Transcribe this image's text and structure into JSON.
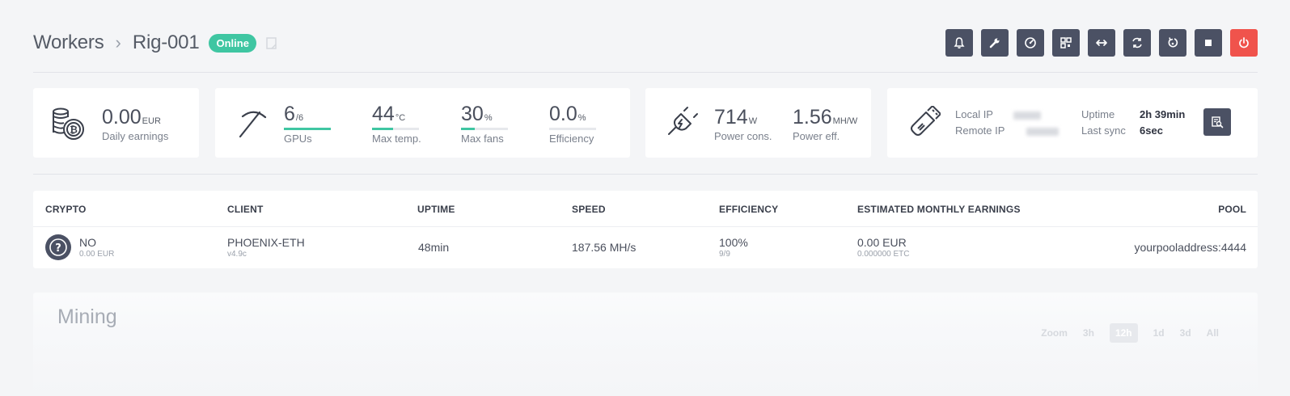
{
  "header": {
    "breadcrumb_root": "Workers",
    "separator": "›",
    "rig_name": "Rig-001",
    "status": "Online",
    "colors": {
      "status": "#3fc6a2",
      "action_bg": "#4b5164",
      "danger": "#f0534c"
    },
    "actions": [
      {
        "name": "notifications-button",
        "icon": "bell-icon"
      },
      {
        "name": "settings-button",
        "icon": "wrench-icon"
      },
      {
        "name": "overclock-button",
        "icon": "gauge-icon"
      },
      {
        "name": "qr-button",
        "icon": "qrcode-icon"
      },
      {
        "name": "transfer-button",
        "icon": "arrows-horizontal-icon"
      },
      {
        "name": "sync-button",
        "icon": "sync-icon"
      },
      {
        "name": "restart-button",
        "icon": "restart-icon"
      },
      {
        "name": "stop-button",
        "icon": "stop-icon"
      },
      {
        "name": "power-button",
        "icon": "power-icon"
      }
    ]
  },
  "earnings": {
    "value": "0.00",
    "unit": "EUR",
    "label": "Daily earnings"
  },
  "gpus": {
    "value": "6",
    "unit": "/6",
    "label": "GPUs",
    "level": 1.0
  },
  "temp": {
    "value": "44",
    "unit": "°C",
    "label": "Max temp.",
    "level": 0.44
  },
  "fans": {
    "value": "30",
    "unit": "%",
    "label": "Max fans",
    "level": 0.3
  },
  "efficiency": {
    "value": "0.0",
    "unit": "%",
    "label": "Efficiency",
    "level": 0.0
  },
  "power": {
    "value": "714",
    "unit": "W",
    "label": "Power cons."
  },
  "power_eff": {
    "value": "1.56",
    "unit": "MH/W",
    "label": "Power eff."
  },
  "network": {
    "local_ip_label": "Local IP",
    "local_ip_value": "",
    "remote_ip_label": "Remote IP",
    "remote_ip_value": "",
    "uptime_label": "Uptime",
    "uptime_value": "2h 39min",
    "last_sync_label": "Last sync",
    "last_sync_value": "6sec"
  },
  "table": {
    "headers": [
      "CRYPTO",
      "CLIENT",
      "UPTIME",
      "SPEED",
      "EFFICIENCY",
      "ESTIMATED MONTHLY EARNINGS",
      "POOL"
    ],
    "row": {
      "crypto": "NO",
      "crypto_sub": "0.00 EUR",
      "client": "PHOENIX-ETH",
      "client_sub": "v4.9c",
      "uptime": "48min",
      "speed": "187.56 MH/s",
      "efficiency": "100%",
      "efficiency_sub": "9/9",
      "earnings": "0.00 EUR",
      "earnings_sub": "0.000000 ETC",
      "pool": "yourpooladdress:4444"
    }
  },
  "mining": {
    "title": "Mining",
    "zoom_label": "Zoom",
    "zoom_options": [
      "3h",
      "12h",
      "1d",
      "3d",
      "All"
    ],
    "zoom_selected": "12h"
  }
}
